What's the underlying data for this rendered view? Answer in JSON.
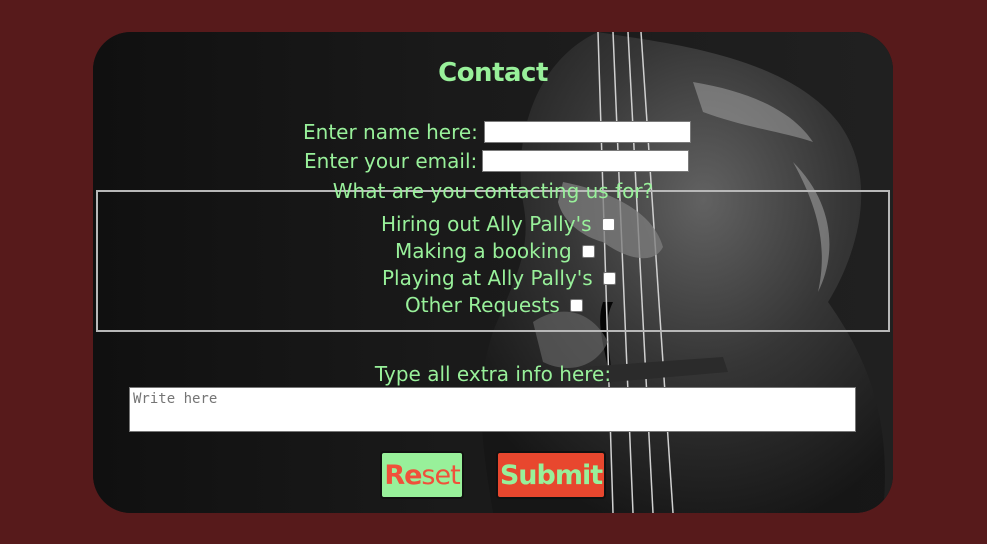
{
  "form": {
    "title": "Contact",
    "name_label": "Enter name here:",
    "name_value": "",
    "email_label": "Enter your email:",
    "email_value": "",
    "fieldset_legend": "What are you contacting us for?",
    "options": [
      {
        "label": "Hiring out Ally Pally's",
        "checked": false
      },
      {
        "label": "Making a booking",
        "checked": false
      },
      {
        "label": "Playing at Ally Pally's",
        "checked": false
      },
      {
        "label": "Other Requests",
        "checked": false
      }
    ],
    "extra_label": "Type all extra info here:",
    "extra_placeholder": "Write here",
    "reset_bold": "Re",
    "reset_rest": "set",
    "submit_label": "Submit"
  },
  "colors": {
    "page_bg": "#571a1b",
    "card_bg": "#121212",
    "text_green": "#98f09a",
    "accent_red": "#e8472e"
  }
}
